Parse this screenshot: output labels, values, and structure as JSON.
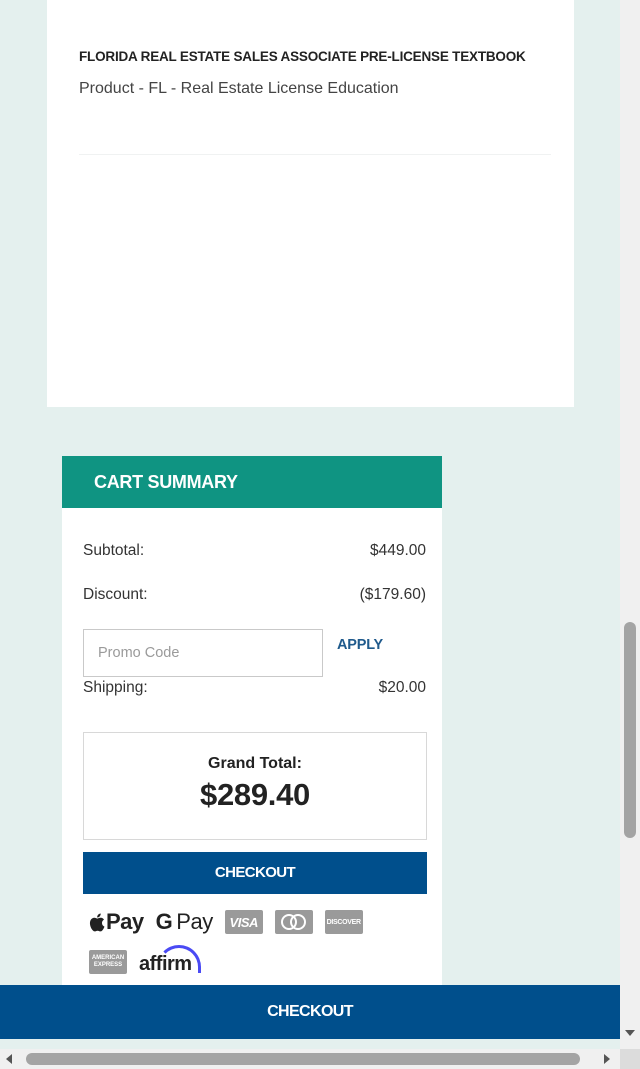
{
  "product": {
    "title": "FLORIDA REAL ESTATE SALES ASSOCIATE PRE-LICENSE TEXTBOOK",
    "subtitle": "Product - FL - Real Estate License Education"
  },
  "cart_summary": {
    "heading": "CART SUMMARY",
    "subtotal_label": "Subtotal:",
    "subtotal_value": "$449.00",
    "discount_label": "Discount:",
    "discount_value": "($179.60)",
    "promo_placeholder": "Promo Code",
    "promo_value": "",
    "apply_label": "APPLY",
    "shipping_label": "Shipping:",
    "shipping_value": "$20.00",
    "grand_total_label": "Grand Total:",
    "grand_total_value": "$289.40",
    "checkout_label": "CHECKOUT"
  },
  "payment_methods": {
    "apple_pay": "Pay",
    "google_pay": "Pay",
    "visa": "VISA",
    "discover": "DISCOVER",
    "amex": "AMERICAN EXPRESS",
    "affirm": "affirm"
  },
  "sticky_footer": {
    "checkout_label": "CHECKOUT"
  },
  "colors": {
    "page_background": "#e4f0ee",
    "cart_header": "#0f9482",
    "checkout_button": "#004f8c",
    "apply_link": "#1f5a8c"
  }
}
